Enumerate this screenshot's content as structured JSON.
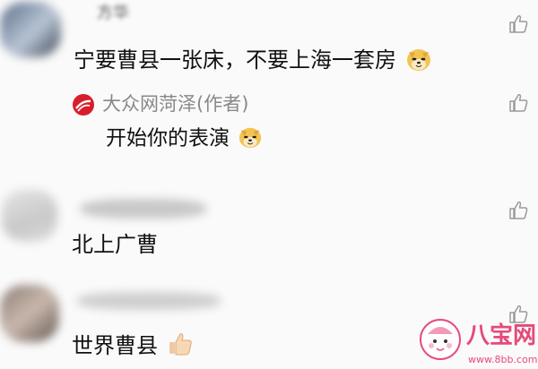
{
  "comments": [
    {
      "id": "c1",
      "username": "方华",
      "text": "宁要曹县一张床，不要上海一套房",
      "emoji": "doge-face-icon"
    },
    {
      "id": "c2",
      "username": "",
      "text": "北上广曹",
      "emoji": ""
    },
    {
      "id": "c3",
      "username": "",
      "text": "世界曹县",
      "emoji": "thumbs-up-emoji-icon"
    }
  ],
  "reply": {
    "author": "大众网菏泽(作者)",
    "text": "开始你的表演",
    "emoji": "doge-face-icon"
  },
  "watermark": {
    "brand": "八宝网",
    "url": "www.8bb.com"
  },
  "colors": {
    "text": "#111111",
    "reply_author": "#888888",
    "icon": "#9a9a9a",
    "watermark": "#e64a7a",
    "background": "#fafafa"
  }
}
